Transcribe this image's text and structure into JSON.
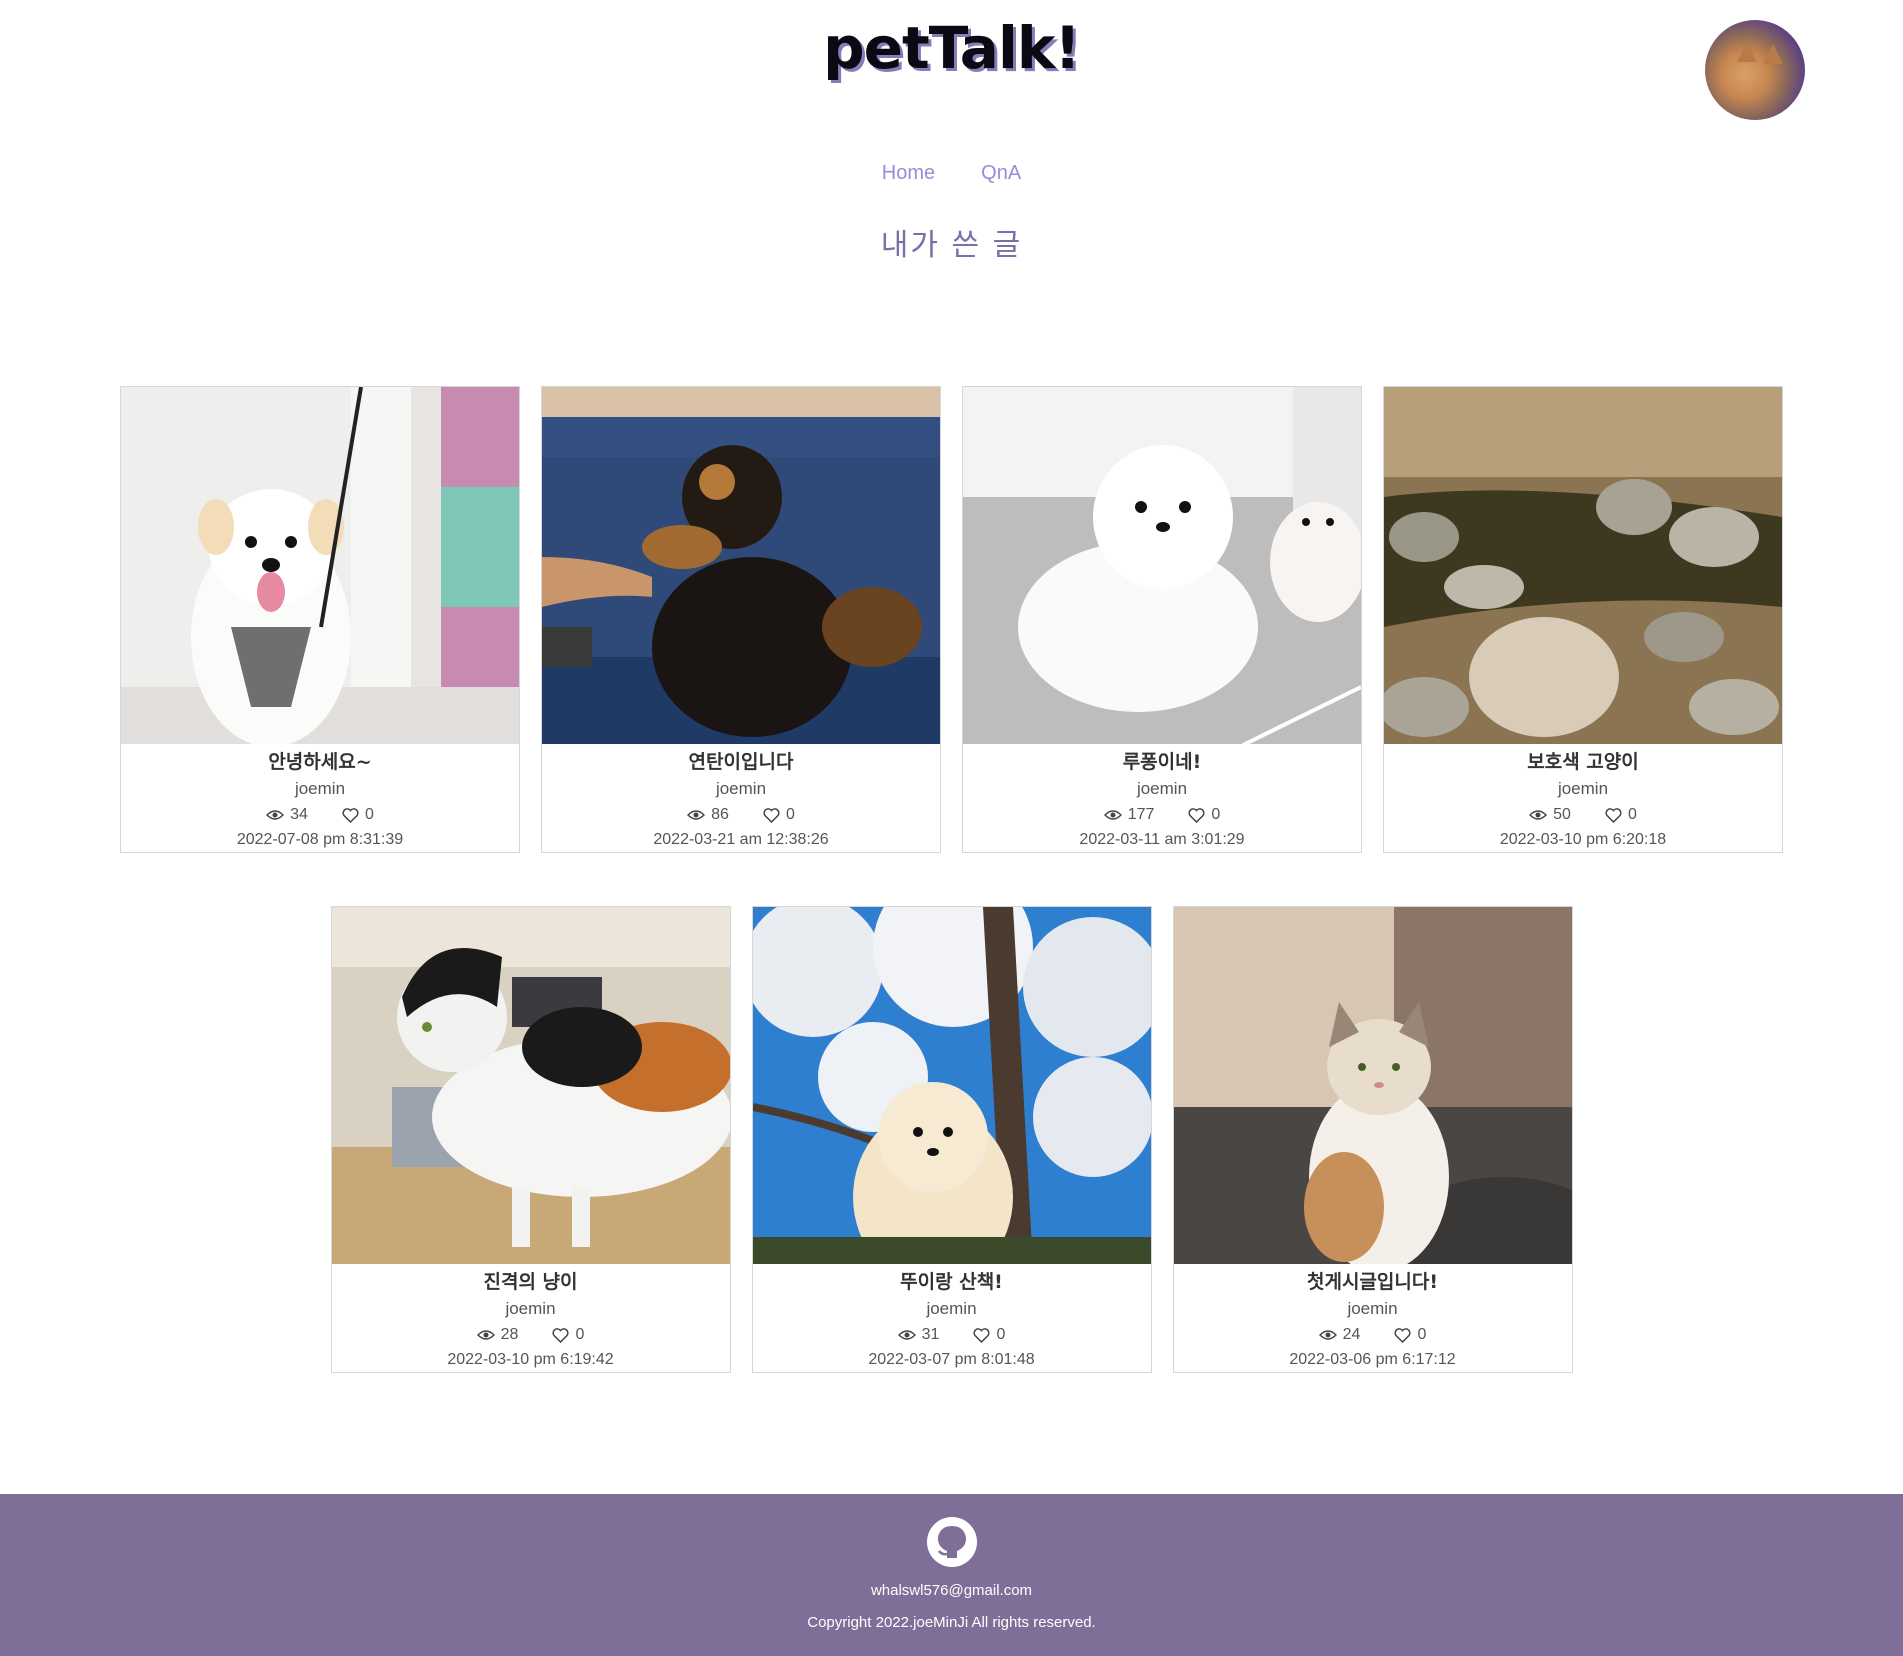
{
  "header": {
    "logo": "petTalk!"
  },
  "nav": {
    "items": [
      "Home",
      "QnA"
    ]
  },
  "page": {
    "title": "내가 쓴 글"
  },
  "posts": [
    {
      "title": "안녕하세요~",
      "author": "joemin",
      "views": "34",
      "likes": "0",
      "date": "2022-07-08 pm 8:31:39"
    },
    {
      "title": "연탄이입니다",
      "author": "joemin",
      "views": "86",
      "likes": "0",
      "date": "2022-03-21 am 12:38:26"
    },
    {
      "title": "루퐁이네!",
      "author": "joemin",
      "views": "177",
      "likes": "0",
      "date": "2022-03-11 am 3:01:29"
    },
    {
      "title": "보호색 고양이",
      "author": "joemin",
      "views": "50",
      "likes": "0",
      "date": "2022-03-10 pm 6:20:18"
    },
    {
      "title": "진격의 냥이",
      "author": "joemin",
      "views": "28",
      "likes": "0",
      "date": "2022-03-10 pm 6:19:42"
    },
    {
      "title": "뚜이랑 산책!",
      "author": "joemin",
      "views": "31",
      "likes": "0",
      "date": "2022-03-07 pm 8:01:48"
    },
    {
      "title": "첫게시글입니다!",
      "author": "joemin",
      "views": "24",
      "likes": "0",
      "date": "2022-03-06 pm 6:17:12"
    }
  ],
  "footer": {
    "email": "whalswl576@gmail.com",
    "copyright": "Copyright 2022.joeMinJi All rights reserved."
  },
  "colors": {
    "accent": "#9b8ad8",
    "footer_bg": "#7f6e97",
    "title": "#7a6fa8"
  }
}
